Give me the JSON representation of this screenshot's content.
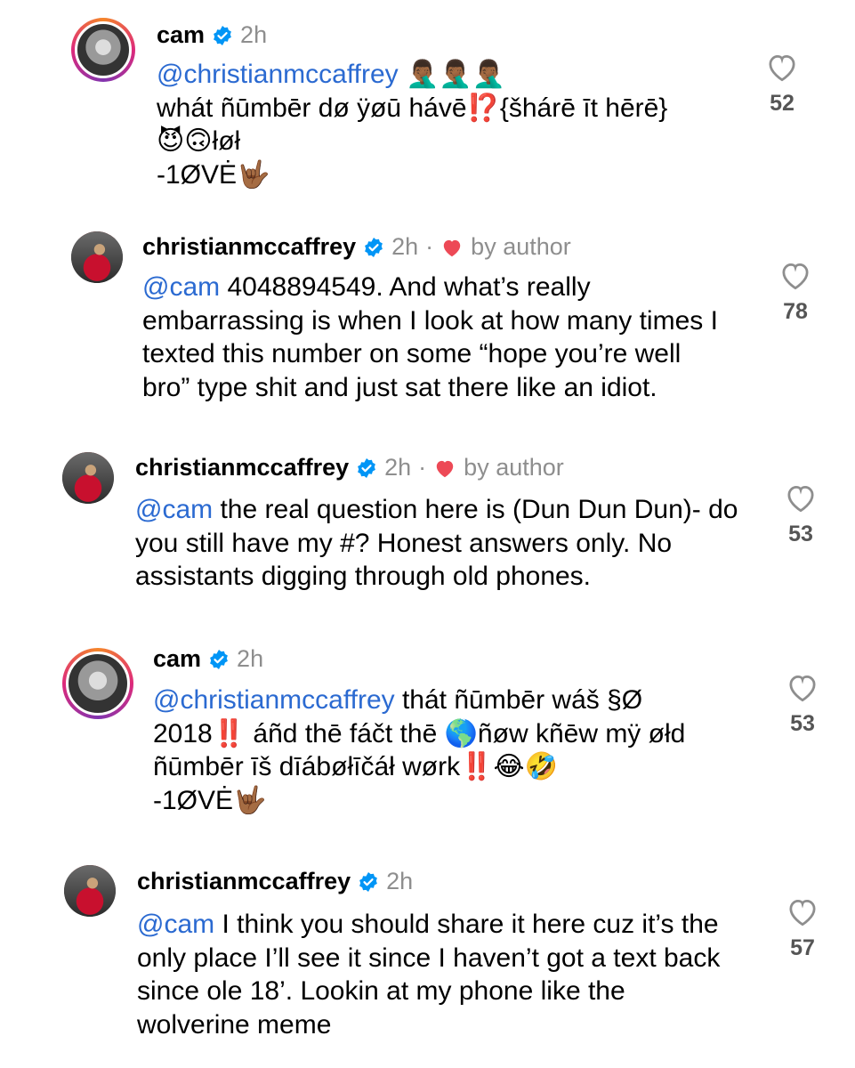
{
  "comments": [
    {
      "username": "cam",
      "time": "2h",
      "by_author": "",
      "mention": "@christianmccaffrey",
      "lines": [
        " 🤦🏾‍♂️🤦🏾‍♂️🤦🏾‍♂️",
        "whát ñūmbēr dø ÿøū hávē⁉️{šhárē īt hērē}",
        "😈🙃łøł",
        "-1ØVĖ🤟🏾"
      ],
      "likes": "52"
    },
    {
      "username": "christianmccaffrey",
      "time": "2h",
      "dot": "·",
      "by_author": "by author",
      "mention": "@cam",
      "text": " 4048894549. And what’s really embarrassing is when I look at how many times I texted this number on some “hope you’re well bro” type shit and just sat there like an idiot.",
      "likes": "78"
    },
    {
      "username": "christianmccaffrey",
      "time": "2h",
      "dot": "·",
      "by_author": "by author",
      "mention": "@cam",
      "text": " the real question here is (Dun Dun Dun)- do you still have my #? Honest answers only. No assistants digging through old phones.",
      "likes": "53"
    },
    {
      "username": "cam",
      "time": "2h",
      "mention": "@christianmccaffrey",
      "text": " thát ñūmbēr wáš §Ø 2018‼️ áñd thē fáčt thē 🌎ñøw kñēw mÿ øłd ñūmbēr īš dīábøłīčáł wørk‼️😂🤣",
      "extra": "-1ØVĖ🤟🏾",
      "likes": "53"
    },
    {
      "username": "christianmccaffrey",
      "time": "2h",
      "mention": "@cam",
      "text": " I think you should share it here cuz it’s the only place I’ll see it since I haven’t got a text back since ole 18’. Lookin at my phone like the wolverine meme",
      "likes": "57"
    }
  ],
  "colors": {
    "mention": "#2b6ad1",
    "verified": "#0095f6",
    "heart_red": "#ed4956",
    "meta": "#8e8e8e"
  },
  "icons": {
    "verified": "verified-badge-icon",
    "like": "heart-outline-icon",
    "author_like": "heart-filled-icon"
  }
}
